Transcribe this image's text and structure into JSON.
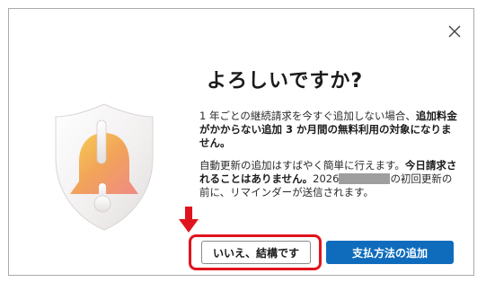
{
  "dialog": {
    "title": "よろしいですか?",
    "paragraph1": {
      "text_normal": "1 年ごとの継続請求を今すぐ追加しない場合、",
      "text_bold": "追加料金がかからない追加 3 か月間の無料利用の対象になりません。"
    },
    "paragraph2": {
      "text_normal_1": "自動更新の追加はすばやく簡単に行えます。",
      "text_bold": "今日請求されることはありません。",
      "text_normal_2": "2026",
      "text_normal_3": "の初回更新の前に、リマインダーが送信されます。"
    },
    "buttons": {
      "no_label": "いいえ、結構です",
      "add_payment_label": "支払方法の追加"
    }
  },
  "colors": {
    "primary": "#0f6cbd",
    "highlight": "#e0141e",
    "redaction": "#9e9e9e"
  },
  "icons": {
    "close": "close-icon",
    "illustration": "bell-shield-icon",
    "annotation": "red-arrow-icon"
  }
}
